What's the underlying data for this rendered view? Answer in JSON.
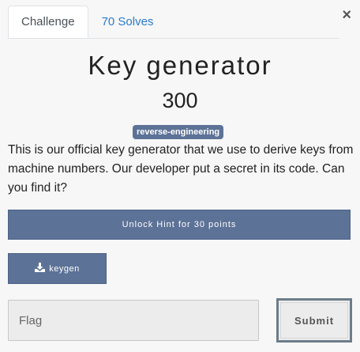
{
  "tabs": [
    {
      "label": "Challenge",
      "active": true
    },
    {
      "label": "70 Solves",
      "active": false
    }
  ],
  "close_symbol": "×",
  "challenge": {
    "name": "Key generator",
    "points": "300",
    "tag": "reverse-engineering",
    "description": "This is our official key generator that we use to derive keys from machine numbers. Our developer put a secret in its code. Can you find it?"
  },
  "hint": {
    "label": "Unlock Hint for 30 points"
  },
  "files": [
    {
      "name": "keygen",
      "icon": "download-icon"
    }
  ],
  "submission": {
    "placeholder": "Flag",
    "value": "",
    "submit_label": "Submit"
  },
  "colors": {
    "accent": "#5d7297",
    "link": "#2b7bcb",
    "background": "#f7f7f7"
  }
}
